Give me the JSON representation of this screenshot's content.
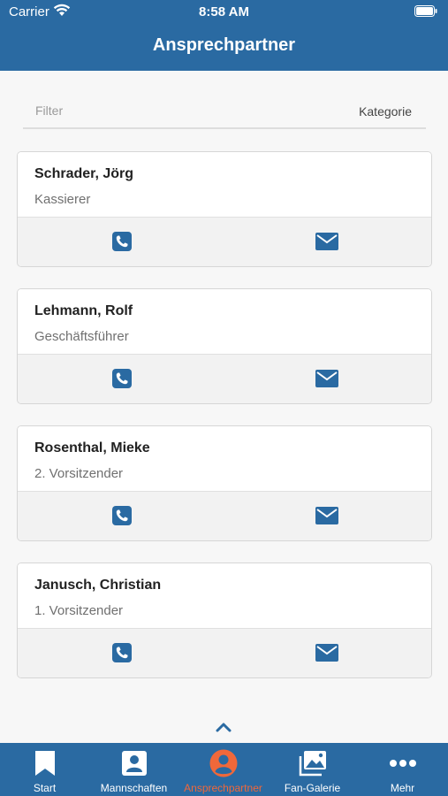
{
  "status_bar": {
    "carrier": "Carrier",
    "time": "8:58 AM"
  },
  "header": {
    "title": "Ansprechpartner"
  },
  "filter": {
    "placeholder": "Filter",
    "value": "",
    "category_label": "Kategorie"
  },
  "contacts": [
    {
      "name": "Schrader, Jörg",
      "role": "Kassierer"
    },
    {
      "name": "Lehmann, Rolf",
      "role": "Geschäftsführer"
    },
    {
      "name": "Rosenthal, Mieke",
      "role": "2. Vorsitzender"
    },
    {
      "name": "Janusch, Christian",
      "role": "1. Vorsitzender"
    }
  ],
  "tabs": [
    {
      "label": "Start",
      "icon": "bookmark-icon"
    },
    {
      "label": "Mannschaften",
      "icon": "contact-card-icon"
    },
    {
      "label": "Ansprechpartner",
      "icon": "person-circle-icon",
      "active": true
    },
    {
      "label": "Fan-Galerie",
      "icon": "gallery-icon"
    },
    {
      "label": "Mehr",
      "icon": "more-dots-icon"
    }
  ],
  "colors": {
    "brand": "#2a6aa2",
    "active_tab": "#f0683a",
    "icon_blue": "#2a6aa2"
  }
}
